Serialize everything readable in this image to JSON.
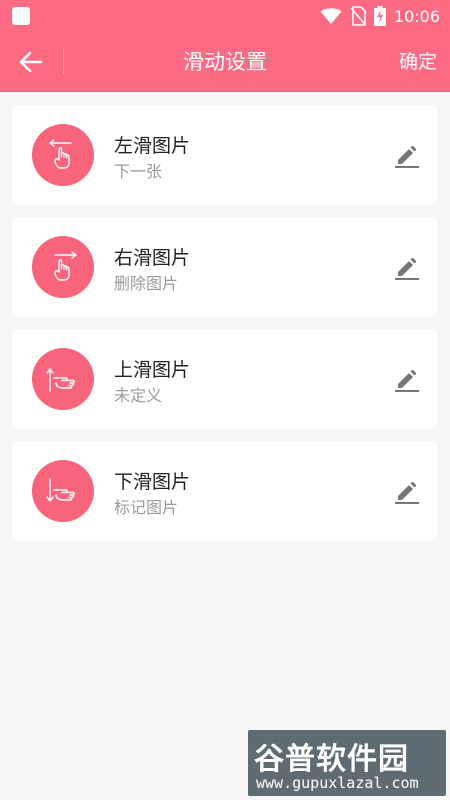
{
  "status_bar": {
    "time": "10:06",
    "icons": [
      "notification-icon",
      "wifi-icon",
      "no-sim-icon",
      "battery-charging-icon"
    ]
  },
  "toolbar": {
    "title": "滑动设置",
    "confirm_label": "确定",
    "back_icon": "arrow-left-icon"
  },
  "colors": {
    "primary": "#fc6a84",
    "avatar": "#f7647c",
    "background": "#f6f6f6"
  },
  "gestures": [
    {
      "title": "左滑图片",
      "subtitle": "下一张",
      "icon": "swipe-left-icon"
    },
    {
      "title": "右滑图片",
      "subtitle": "删除图片",
      "icon": "swipe-right-icon"
    },
    {
      "title": "上滑图片",
      "subtitle": "未定义",
      "icon": "swipe-up-icon"
    },
    {
      "title": "下滑图片",
      "subtitle": "标记图片",
      "icon": "swipe-down-icon"
    }
  ],
  "watermark": {
    "name": "谷普软件园",
    "url": "www.gupuxlazal.com"
  }
}
